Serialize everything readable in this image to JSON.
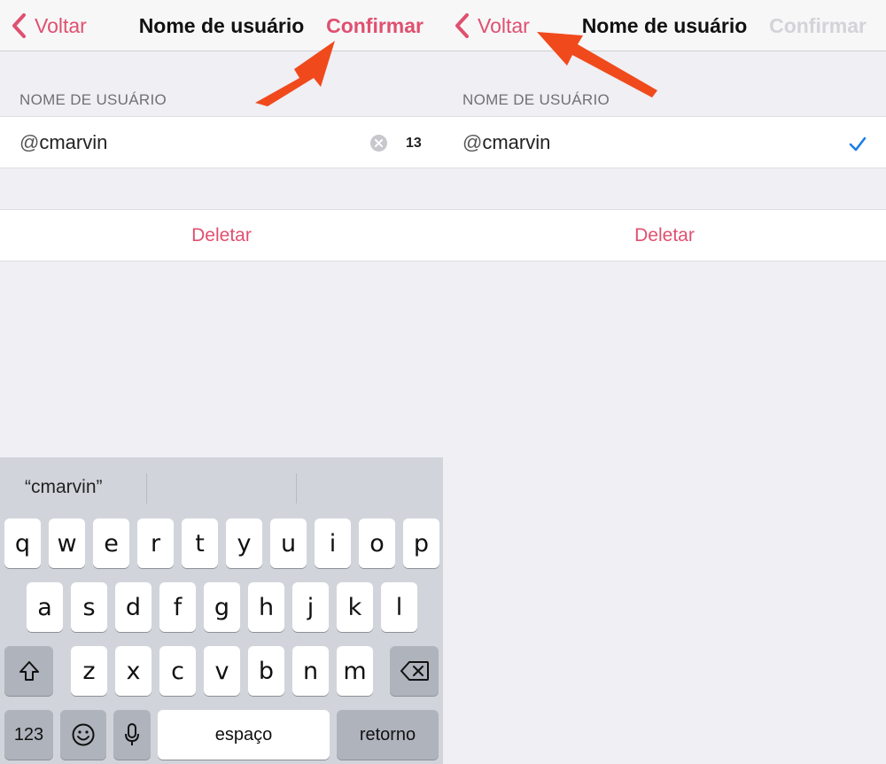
{
  "colors": {
    "accent": "#e0506f",
    "disabled": "#d3d3d8",
    "check": "#1a7ee6",
    "arrow": "#f04a1c"
  },
  "left_screen": {
    "navbar": {
      "back_label": "Voltar",
      "title": "Nome de usuário",
      "confirm_label": "Confirmar"
    },
    "section_header": "NOME DE USUÁRIO",
    "username": {
      "prefix": "@",
      "value": "cmarvin",
      "char_count": "13"
    },
    "delete_label": "Deletar",
    "keyboard": {
      "suggestions": [
        "“cmarvin”",
        "",
        ""
      ],
      "row1": [
        "q",
        "w",
        "e",
        "r",
        "t",
        "y",
        "u",
        "i",
        "o",
        "p"
      ],
      "row2": [
        "a",
        "s",
        "d",
        "f",
        "g",
        "h",
        "j",
        "k",
        "l"
      ],
      "row3": [
        "z",
        "x",
        "c",
        "v",
        "b",
        "n",
        "m"
      ],
      "numbers_label": "123",
      "space_label": "espaço",
      "return_label": "retorno",
      "icons": {
        "shift": "shift-icon",
        "backspace": "backspace-icon",
        "emoji": "emoji-icon",
        "mic": "microphone-icon"
      }
    }
  },
  "right_screen": {
    "navbar": {
      "back_label": "Voltar",
      "title": "Nome de usuário",
      "confirm_label": "Confirmar"
    },
    "section_header": "NOME DE USUÁRIO",
    "username": {
      "prefix": "@",
      "value": "cmarvin"
    },
    "delete_label": "Deletar",
    "icons": {
      "saved": "checkmark-icon"
    }
  }
}
